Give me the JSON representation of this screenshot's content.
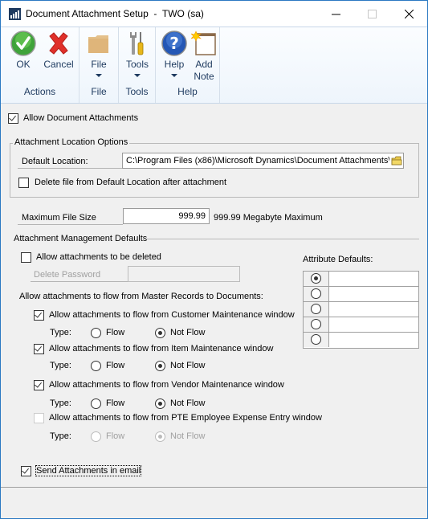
{
  "window": {
    "title": "Document Attachment Setup  -  TWO (sa)",
    "controls": {
      "minimize": "—",
      "maximize": "☐",
      "close": "✕"
    }
  },
  "ribbon": {
    "groups": [
      {
        "label": "Actions",
        "buttons": [
          {
            "label": "OK",
            "icon": "ok-check-icon"
          },
          {
            "label": "Cancel",
            "icon": "cancel-x-icon"
          }
        ]
      },
      {
        "label": "File",
        "buttons": [
          {
            "label": "File",
            "icon": "folder-icon",
            "dropdown": true
          }
        ]
      },
      {
        "label": "Tools",
        "buttons": [
          {
            "label": "Tools",
            "icon": "tools-icon",
            "dropdown": true
          }
        ]
      },
      {
        "label": "Help",
        "buttons": [
          {
            "label": "Help",
            "icon": "help-icon",
            "dropdown": true
          },
          {
            "label": "Add Note",
            "line1": "Add",
            "line2": "Note",
            "icon": "add-note-icon"
          }
        ]
      }
    ]
  },
  "form": {
    "allow_document_attachments": {
      "label": "Allow Document Attachments",
      "checked": true
    },
    "location_options": {
      "legend": "Attachment Location Options",
      "default_location_label": "Default Location:",
      "default_location_value": "C:\\Program Files (x86)\\Microsoft Dynamics\\Document Attachments\\",
      "delete_after_attachment": {
        "label": "Delete file from Default Location after attachment",
        "checked": false
      }
    },
    "max_file_size": {
      "label": "Maximum File Size",
      "value": "999.99",
      "note": "999.99 Megabyte Maximum"
    },
    "management_defaults": {
      "heading": "Attachment Management Defaults",
      "allow_delete": {
        "label": "Allow attachments to be deleted",
        "checked": false
      },
      "delete_password": {
        "label": "Delete Password",
        "value": ""
      },
      "flow_heading": "Allow attachments to flow from Master Records to Documents:",
      "type_label": "Type:",
      "flow_label": "Flow",
      "not_flow_label": "Not Flow",
      "flows": [
        {
          "label": "Allow attachments to flow from Customer Maintenance window",
          "checked": true,
          "enabled": true,
          "selected": "Not Flow"
        },
        {
          "label": "Allow attachments to flow from Item Maintenance window",
          "checked": true,
          "enabled": true,
          "selected": "Not Flow"
        },
        {
          "label": "Allow attachments to flow from Vendor Maintenance window",
          "checked": true,
          "enabled": true,
          "selected": "Not Flow"
        },
        {
          "label": "Allow attachments to flow from PTE Employee Expense Entry window",
          "checked": false,
          "enabled": false,
          "selected": "Not Flow"
        }
      ],
      "attribute_defaults": {
        "label": "Attribute Defaults:",
        "rows": [
          {
            "selected": true,
            "value": ""
          },
          {
            "selected": false,
            "value": ""
          },
          {
            "selected": false,
            "value": ""
          },
          {
            "selected": false,
            "value": ""
          },
          {
            "selected": false,
            "value": ""
          }
        ]
      }
    },
    "send_in_email": {
      "label": "Send Attachments in email",
      "checked": true
    }
  },
  "colors": {
    "window_border": "#2b79c2",
    "ribbon_text": "#1e3a5f",
    "disabled_text": "#a0a0a0"
  }
}
